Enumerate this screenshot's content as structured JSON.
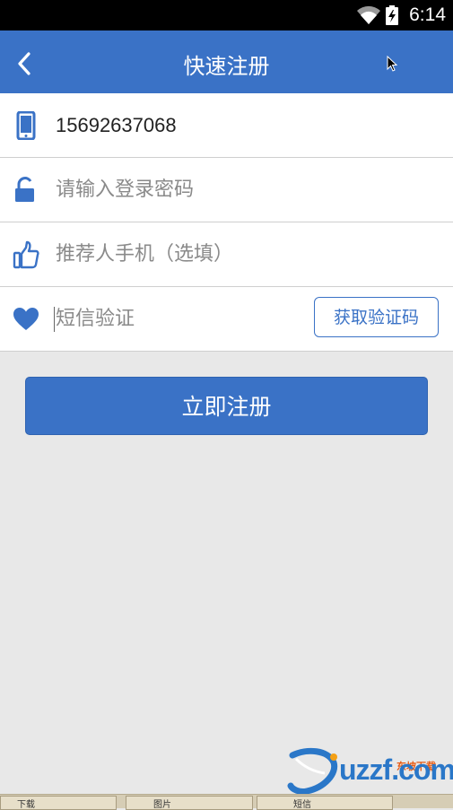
{
  "status_bar": {
    "time": "6:14",
    "wifi_icon": "wifi-icon",
    "battery_icon": "battery-charging-icon"
  },
  "header": {
    "title": "快速注册",
    "back_icon": "chevron-left-icon"
  },
  "form": {
    "phone": {
      "icon": "phone-icon",
      "value": "15692637068"
    },
    "password": {
      "icon": "unlock-icon",
      "placeholder": "请输入登录密码"
    },
    "referrer": {
      "icon": "thumbs-up-icon",
      "placeholder": "推荐人手机（选填）"
    },
    "sms": {
      "icon": "heart-icon",
      "placeholder": "短信验证",
      "button_label": "获取验证码"
    }
  },
  "register_button": {
    "label": "立即注册"
  },
  "watermark": {
    "logo_text": "uzzf.com",
    "cn_text": "东坡下载"
  },
  "taskbar": {
    "items": [
      "下载",
      "图片",
      "短信"
    ]
  },
  "colors": {
    "primary": "#3a72c6",
    "background": "#e8e8e8",
    "status_bar": "#000000"
  }
}
